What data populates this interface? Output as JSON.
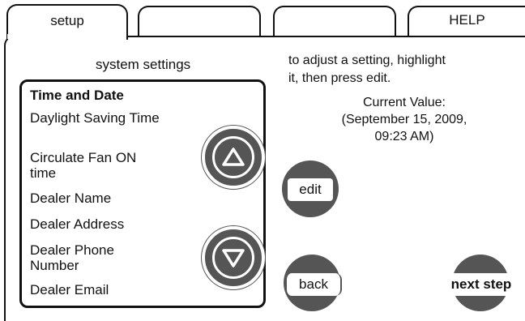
{
  "tabs": [
    {
      "label": "setup",
      "active": true
    },
    {
      "label": "",
      "active": false
    },
    {
      "label": "",
      "active": false
    },
    {
      "label": "HELP",
      "active": false
    }
  ],
  "settings_panel": {
    "title": "system settings",
    "items": [
      {
        "label": "Time and Date",
        "selected": true
      },
      {
        "label": "Daylight Saving Time",
        "selected": false
      },
      {
        "label": "Circulate Fan ON time",
        "selected": false
      },
      {
        "label": "Dealer Name",
        "selected": false
      },
      {
        "label": "Dealer Address",
        "selected": false
      },
      {
        "label": "Dealer Phone Number",
        "selected": false
      },
      {
        "label": "Dealer Email",
        "selected": false
      }
    ]
  },
  "instructions": {
    "line1": "to adjust a setting, highlight",
    "line2": "it, then press edit.",
    "current_value_label": "Current Value:",
    "current_value_line1": "(September 15, 2009,",
    "current_value_line2": "09:23 AM)"
  },
  "buttons": {
    "edit": "edit",
    "back": "back",
    "next_step": "next step"
  },
  "colors": {
    "button_gray": "#555555",
    "border": "#111111"
  }
}
